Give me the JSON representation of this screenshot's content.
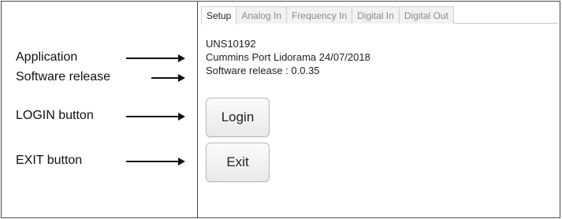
{
  "annotations": {
    "application": "Application",
    "software_release": "Software release",
    "login_button": "LOGIN button",
    "exit_button": "EXIT button"
  },
  "tabs": [
    "Setup",
    "Analog In",
    "Frequency In",
    "Digital In",
    "Digital Out"
  ],
  "active_tab": "Setup",
  "info": {
    "unit_id": "UNS10192",
    "application": "Cummins Port Lidorama 24/07/2018",
    "software_release": "Software release : 0.0.35"
  },
  "buttons": {
    "login": "Login",
    "exit": "Exit"
  }
}
